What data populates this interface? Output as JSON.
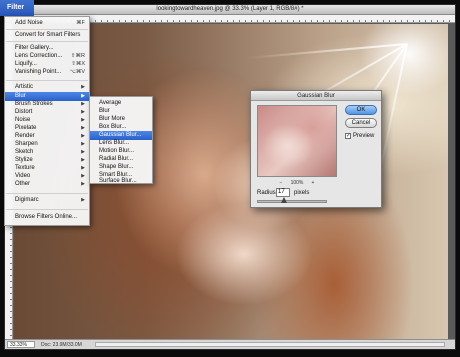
{
  "window": {
    "title": "lookingtowardheaven.jpg @ 33.3% (Layer 1, RGB/8#) *",
    "zoom": "33.33%",
    "doc_info": "Doc: 23.9M/33.0M"
  },
  "menubar": {
    "filter_label": "Filter"
  },
  "filter_menu": {
    "items": [
      {
        "label": "Add Noise",
        "shortcut": "⌘F"
      },
      {
        "label": "Convert for Smart Filters",
        "shortcut": ""
      },
      {
        "label": "Filter Gallery...",
        "shortcut": ""
      },
      {
        "label": "Lens Correction...",
        "shortcut": "⇧⌘R"
      },
      {
        "label": "Liquify...",
        "shortcut": "⇧⌘X"
      },
      {
        "label": "Vanishing Point...",
        "shortcut": "⌥⌘V"
      },
      {
        "label": "Artistic",
        "submenu": true
      },
      {
        "label": "Blur",
        "submenu": true,
        "selected": true
      },
      {
        "label": "Brush Strokes",
        "submenu": true
      },
      {
        "label": "Distort",
        "submenu": true
      },
      {
        "label": "Noise",
        "submenu": true
      },
      {
        "label": "Pixelate",
        "submenu": true
      },
      {
        "label": "Render",
        "submenu": true
      },
      {
        "label": "Sharpen",
        "submenu": true
      },
      {
        "label": "Sketch",
        "submenu": true
      },
      {
        "label": "Stylize",
        "submenu": true
      },
      {
        "label": "Texture",
        "submenu": true
      },
      {
        "label": "Video",
        "submenu": true
      },
      {
        "label": "Other",
        "submenu": true
      },
      {
        "label": "Digimarc",
        "submenu": true
      },
      {
        "label": "Browse Filters Online...",
        "shortcut": ""
      }
    ]
  },
  "blur_submenu": {
    "items": [
      {
        "label": "Average"
      },
      {
        "label": "Blur"
      },
      {
        "label": "Blur More"
      },
      {
        "label": "Box Blur..."
      },
      {
        "label": "Gaussian Blur...",
        "selected": true
      },
      {
        "label": "Lens Blur..."
      },
      {
        "label": "Motion Blur..."
      },
      {
        "label": "Radial Blur..."
      },
      {
        "label": "Shape Blur..."
      },
      {
        "label": "Smart Blur..."
      },
      {
        "label": "Surface Blur..."
      }
    ]
  },
  "dialog": {
    "title": "Gaussian Blur",
    "ok_label": "OK",
    "cancel_label": "Cancel",
    "preview_label": "Preview",
    "preview_checked": true,
    "preview_zoom": "100%",
    "radius_label": "Radius:",
    "radius_value": "17",
    "radius_units": "pixels"
  }
}
